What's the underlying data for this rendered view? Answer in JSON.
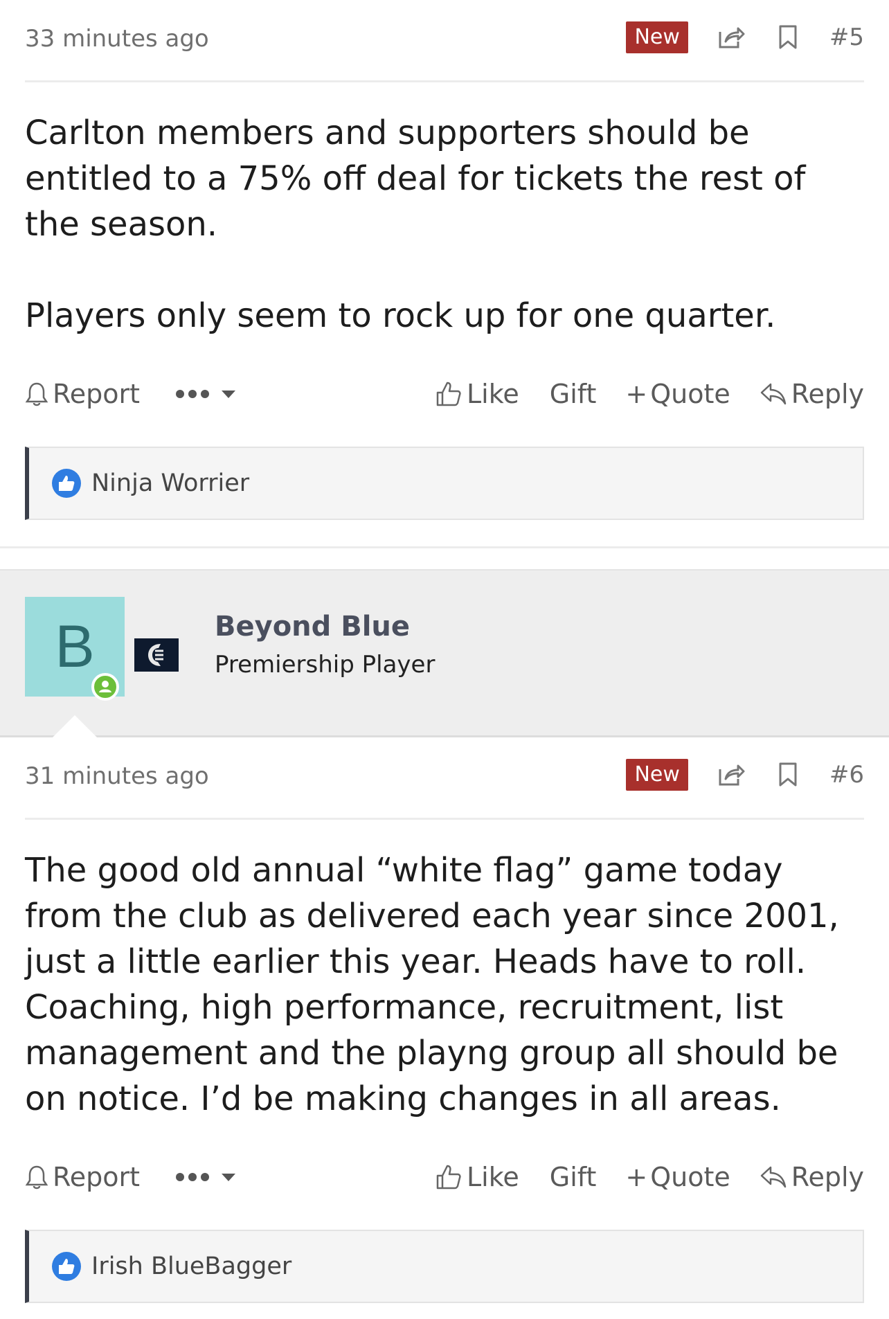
{
  "posts": [
    {
      "time": "33 minutes ago",
      "badge": "New",
      "number": "#5",
      "paragraphs": [
        "Carlton members and supporters should be entitled to a 75% off deal for tickets the rest of the season.",
        "Players only seem to rock up for one quarter."
      ],
      "actions": {
        "report": "Report",
        "like": "Like",
        "gift": "Gift",
        "quote": "Quote",
        "reply": "Reply"
      },
      "reaction_user": "Ninja Worrier"
    },
    {
      "time": "31 minutes ago",
      "badge": "New",
      "number": "#6",
      "paragraphs": [
        "The good old annual “white flag” game today from the club as delivered each year since 2001, just a little earlier this year. Heads have to roll. Coaching, high performance, recruitment, list management and the playng group all should be on notice. I’d be making changes in all areas."
      ],
      "actions": {
        "report": "Report",
        "like": "Like",
        "gift": "Gift",
        "quote": "Quote",
        "reply": "Reply"
      },
      "reaction_user": "Irish BlueBagger"
    }
  ],
  "author2": {
    "avatar_letter": "B",
    "name": "Beyond Blue",
    "title": "Premiership Player"
  },
  "colors": {
    "badge": "#a8302c",
    "avatar_bg": "#9bdcdc",
    "online": "#6cbf3a",
    "like_icon": "#2f7de1"
  }
}
